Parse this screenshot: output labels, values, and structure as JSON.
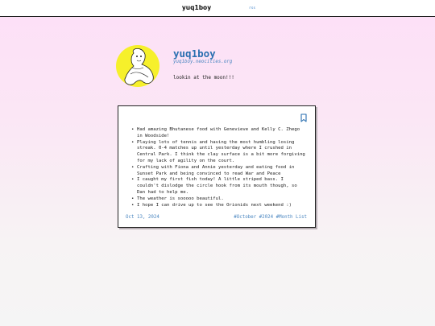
{
  "topbar": {
    "site_name": "yuq1boy",
    "rss_label": "rss"
  },
  "profile": {
    "name": "yuq1boy",
    "url": "yuq1boy.neocities.org",
    "bio": "lookin at the moon!!!"
  },
  "post": {
    "items": [
      "Had amazing Bhutanese food with Genevieve and Kelly C. Zhego in Woodside!",
      "Playing lots of tennis and having the most humbling losing streak. 0-4 matches up until yesterday where I crushed in Central Park. I think the clay surface is a bit more forgiving for my lack of agility on the court.",
      "Crafting with Fiona and Annie yesterday and eating food in Sunset Park and being convinced to read War and Peace",
      "I caught my first fish today! A little striped bass. I couldn't dislodge the circle hook from its mouth though, so Dan had to help me.",
      "The weather is sooooo beautiful.",
      "I hope I can drive up to see the Orionids next weekend :)"
    ],
    "date": "Oct 13, 2024",
    "tags": [
      "#October",
      "#2024",
      "#Month List"
    ]
  },
  "colors": {
    "accent": "#2a6fb0",
    "link": "#4a86c0",
    "avatar_bg": "#f6f02b",
    "page_top": "#fde0f7"
  },
  "icons": {
    "bookmark": "bookmark-icon"
  }
}
